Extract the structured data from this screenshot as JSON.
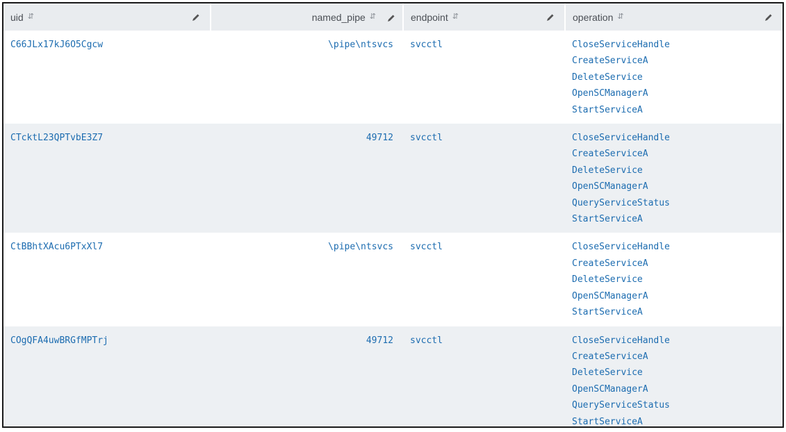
{
  "columns": [
    {
      "label": "uid"
    },
    {
      "label": "named_pipe"
    },
    {
      "label": "endpoint"
    },
    {
      "label": "operation"
    }
  ],
  "rows": [
    {
      "uid": "C66JLx17kJ6O5Cgcw",
      "named_pipe": "\\pipe\\ntsvcs",
      "endpoint": "svcctl",
      "operations": [
        "CloseServiceHandle",
        "CreateServiceA",
        "DeleteService",
        "OpenSCManagerA",
        "StartServiceA"
      ]
    },
    {
      "uid": "CTcktL23QPTvbE3Z7",
      "named_pipe": "49712",
      "endpoint": "svcctl",
      "operations": [
        "CloseServiceHandle",
        "CreateServiceA",
        "DeleteService",
        "OpenSCManagerA",
        "QueryServiceStatus",
        "StartServiceA"
      ]
    },
    {
      "uid": "CtBBhtXAcu6PTxXl7",
      "named_pipe": "\\pipe\\ntsvcs",
      "endpoint": "svcctl",
      "operations": [
        "CloseServiceHandle",
        "CreateServiceA",
        "DeleteService",
        "OpenSCManagerA",
        "StartServiceA"
      ]
    },
    {
      "uid": "COgQFA4uwBRGfMPTrj",
      "named_pipe": "49712",
      "endpoint": "svcctl",
      "operations": [
        "CloseServiceHandle",
        "CreateServiceA",
        "DeleteService",
        "OpenSCManagerA",
        "QueryServiceStatus",
        "StartServiceA"
      ]
    }
  ],
  "icons": {
    "sort": "sort-icon",
    "edit": "pencil-icon"
  },
  "colors": {
    "link": "#1c6cb0",
    "header_bg": "#e9ecef",
    "stripe_bg": "#edf0f3"
  }
}
